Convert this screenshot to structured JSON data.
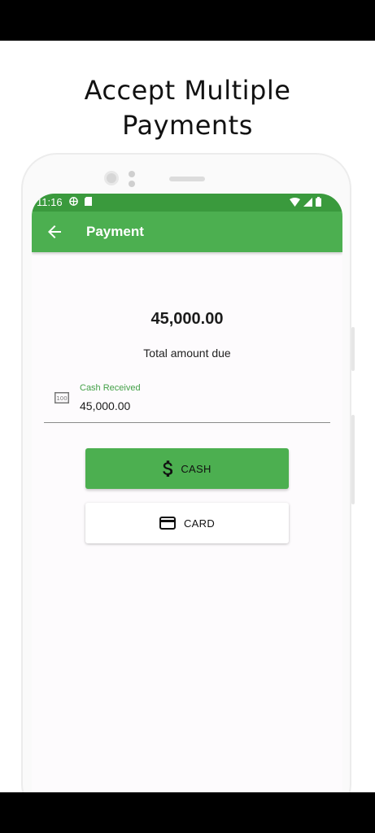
{
  "promo": {
    "headline_line1": "Accept Multiple",
    "headline_line2": "Payments"
  },
  "status_bar": {
    "time": "11:16"
  },
  "app_bar": {
    "title": "Payment"
  },
  "payment": {
    "total_amount": "45,000.00",
    "total_caption": "Total amount due",
    "cash_field_label": "Cash Received",
    "cash_field_value": "45,000.00"
  },
  "buttons": {
    "cash_label": "CASH",
    "card_label": "CARD"
  },
  "icons": {
    "back": "arrow-back-icon",
    "cash": "banknote-icon",
    "dollar": "dollar-icon",
    "card": "credit-card-icon"
  },
  "colors": {
    "primary": "#4caf50",
    "status_bar": "#3a9a3d",
    "accent_text": "#43a047"
  }
}
